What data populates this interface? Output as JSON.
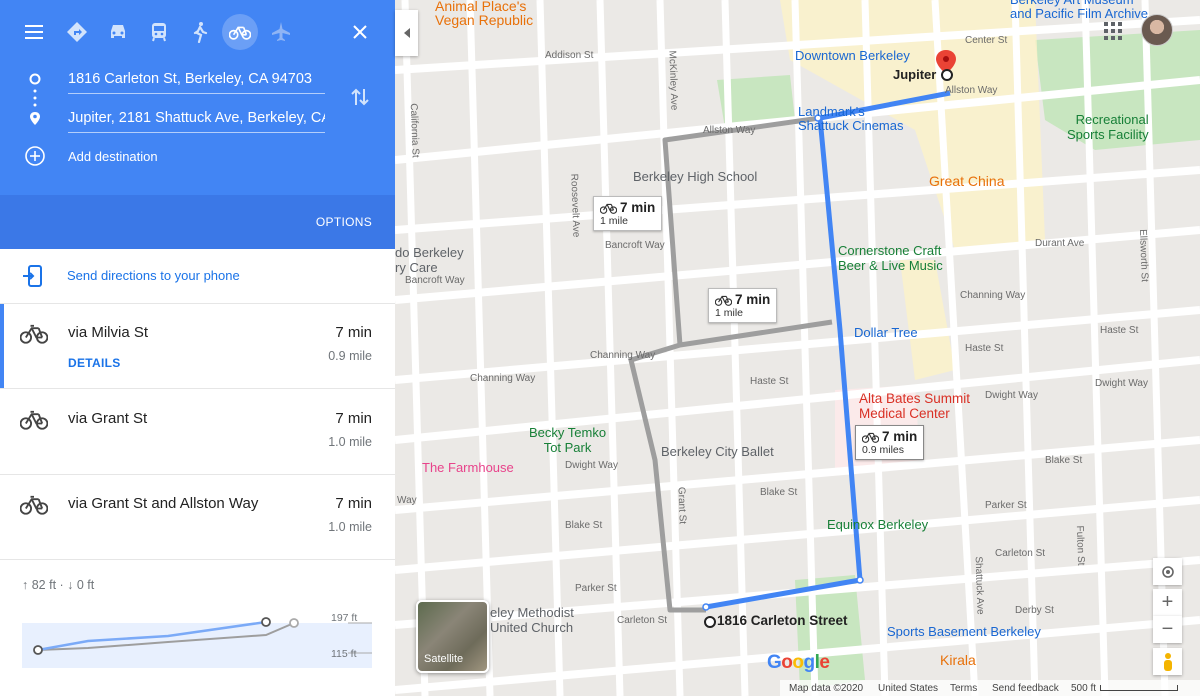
{
  "panel": {
    "travel_modes": [
      "menu-icon",
      "best-travel-icon",
      "car-icon",
      "transit-icon",
      "walk-icon",
      "bicycle-icon",
      "flight-icon"
    ],
    "origin": "1816 Carleton St, Berkeley, CA 94703",
    "destination": "Jupiter, 2181 Shattuck Ave, Berkeley, CA",
    "add_destination": "Add destination",
    "options": "OPTIONS",
    "send_to_phone": "Send directions to your phone",
    "routes": [
      {
        "label": "via Milvia St",
        "time": "7 min",
        "distance": "0.9 mile",
        "details": "DETAILS"
      },
      {
        "label": "via Grant St",
        "time": "7 min",
        "distance": "1.0 mile"
      },
      {
        "label": "via Grant St and Allston Way",
        "time": "7 min",
        "distance": "1.0 mile"
      }
    ],
    "elevation": {
      "summary": "↑ 82 ft · ↓ 0 ft",
      "high_label": "197 ft",
      "low_label": "115 ft"
    }
  },
  "map": {
    "bubbles": [
      {
        "time": "7 min",
        "distance": "1 mile"
      },
      {
        "time": "7 min",
        "distance": "1 mile"
      },
      {
        "time": "7 min",
        "distance": "0.9 miles"
      }
    ],
    "places": {
      "animal_place": "Animal Place's\nVegan Republic",
      "downtown_berkeley": "Downtown Berkeley",
      "jupiter": "Jupiter",
      "landmarks": "Landmark's\nShattuck Cinemas",
      "berkeley_high": "Berkeley High School",
      "recreational": "Recreational\nSports Facility",
      "great_china": "Great China",
      "cornerstone": "Cornerstone Craft\nBeer & Live Music",
      "dollar_tree": "Dollar Tree",
      "alta_bates": "Alta Bates Summit\nMedical Center",
      "becky_temko": "Becky Temko\nTot Park",
      "berkeley_city_ballet": "Berkeley City Ballet",
      "the_farmhouse": "The Farmhouse",
      "equinox": "Equinox Berkeley",
      "origin_label": "1816 Carleton Street",
      "methodist": "eley Methodist\nUnited Church",
      "sports_basement": "Sports Basement Berkeley",
      "kirala": "Kirala",
      "do_berkeley": "do Berkeley\nry Care",
      "art_museum": "Berkeley Art Museum\nand Pacific Film Archive"
    },
    "streets": {
      "addison": "Addison St",
      "allston1": "Allston Way",
      "allston2": "Allston Way",
      "center": "Center St",
      "bancroft1": "Bancroft Way",
      "bancroft2": "Bancroft Way",
      "durant": "Durant Ave",
      "channing1": "Channing Way",
      "channing2": "Channing Way",
      "channing3": "Channing Way",
      "haste1": "Haste St",
      "haste2": "Haste St",
      "haste3": "Haste St",
      "dwight1": "Dwight Way",
      "dwight2": "Dwight Way",
      "dwight3": "Dwight Way",
      "blake1": "Blake St",
      "blake2": "Blake St",
      "blake3": "Blake St",
      "parker1": "Parker St",
      "parker2": "Parker St",
      "carleton1": "Carleton St",
      "carleton2": "Carleton St",
      "derby": "Derby St",
      "grant": "Grant St",
      "mckinley": "McKinley Ave",
      "roosevelt": "Roosevelt Ave",
      "california": "California St",
      "shattuck": "Shattuck Ave",
      "fulton": "Fulton St",
      "ellsworth": "Ellsworth St",
      "way": "Way"
    },
    "satellite": "Satellite",
    "google": "Google",
    "footer": {
      "map_data": "Map data ©2020",
      "country": "United States",
      "terms": "Terms",
      "feedback": "Send feedback",
      "scale": "500 ft"
    },
    "colors": {
      "route_selected": "#4285f4",
      "route_alt": "#9e9e9e",
      "header": "#4285f4"
    }
  }
}
